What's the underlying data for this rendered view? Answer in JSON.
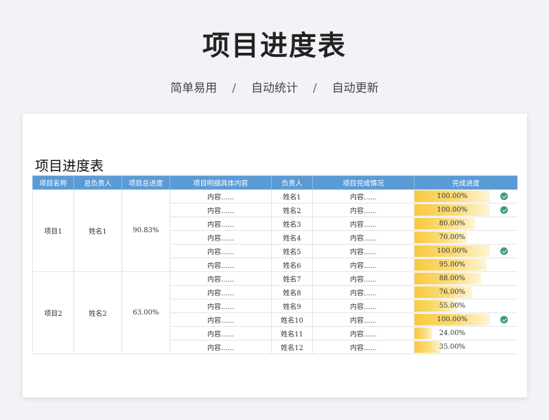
{
  "hero": {
    "title": "项目进度表",
    "features": [
      "简单易用",
      "自动统计",
      "自动更新"
    ],
    "separator": "/"
  },
  "sheet": {
    "title": "项目进度表",
    "headers": [
      "项目名称",
      "总负责人",
      "项目总进度",
      "项目明细具体内容",
      "负责人",
      "项目完成情况",
      "完成进度"
    ],
    "groups": [
      {
        "name": "项目1",
        "owner": "姓名1",
        "total_progress": "90.83%",
        "rows": [
          {
            "detail": "内容......",
            "person": "姓名1",
            "status": "内容......",
            "progress_label": "100.00%",
            "progress": 1.0,
            "done": true
          },
          {
            "detail": "内容......",
            "person": "姓名2",
            "status": "内容......",
            "progress_label": "100.00%",
            "progress": 1.0,
            "done": true
          },
          {
            "detail": "内容......",
            "person": "姓名3",
            "status": "内容......",
            "progress_label": "80.00%",
            "progress": 0.8,
            "done": false
          },
          {
            "detail": "内容......",
            "person": "姓名4",
            "status": "内容......",
            "progress_label": "70.00%",
            "progress": 0.7,
            "done": false
          },
          {
            "detail": "内容......",
            "person": "姓名5",
            "status": "内容......",
            "progress_label": "100.00%",
            "progress": 1.0,
            "done": true
          },
          {
            "detail": "内容......",
            "person": "姓名6",
            "status": "内容......",
            "progress_label": "95.00%",
            "progress": 0.95,
            "done": false
          }
        ]
      },
      {
        "name": "项目2",
        "owner": "姓名2",
        "total_progress": "63.00%",
        "rows": [
          {
            "detail": "内容......",
            "person": "姓名7",
            "status": "内容......",
            "progress_label": "88.00%",
            "progress": 0.88,
            "done": false
          },
          {
            "detail": "内容......",
            "person": "姓名8",
            "status": "内容......",
            "progress_label": "76.00%",
            "progress": 0.76,
            "done": false
          },
          {
            "detail": "内容......",
            "person": "姓名9",
            "status": "内容......",
            "progress_label": "55.00%",
            "progress": 0.55,
            "done": false
          },
          {
            "detail": "内容......",
            "person": "姓名10",
            "status": "内容......",
            "progress_label": "100.00%",
            "progress": 1.0,
            "done": true
          },
          {
            "detail": "内容......",
            "person": "姓名11",
            "status": "内容......",
            "progress_label": "24.00%",
            "progress": 0.24,
            "done": false
          },
          {
            "detail": "内容......",
            "person": "姓名12",
            "status": "内容......",
            "progress_label": "35.00%",
            "progress": 0.35,
            "done": false
          }
        ]
      }
    ],
    "colors": {
      "header_bg": "#5b9bd5",
      "bar": "#f9ca3f",
      "check": "#3d9b7a"
    }
  }
}
